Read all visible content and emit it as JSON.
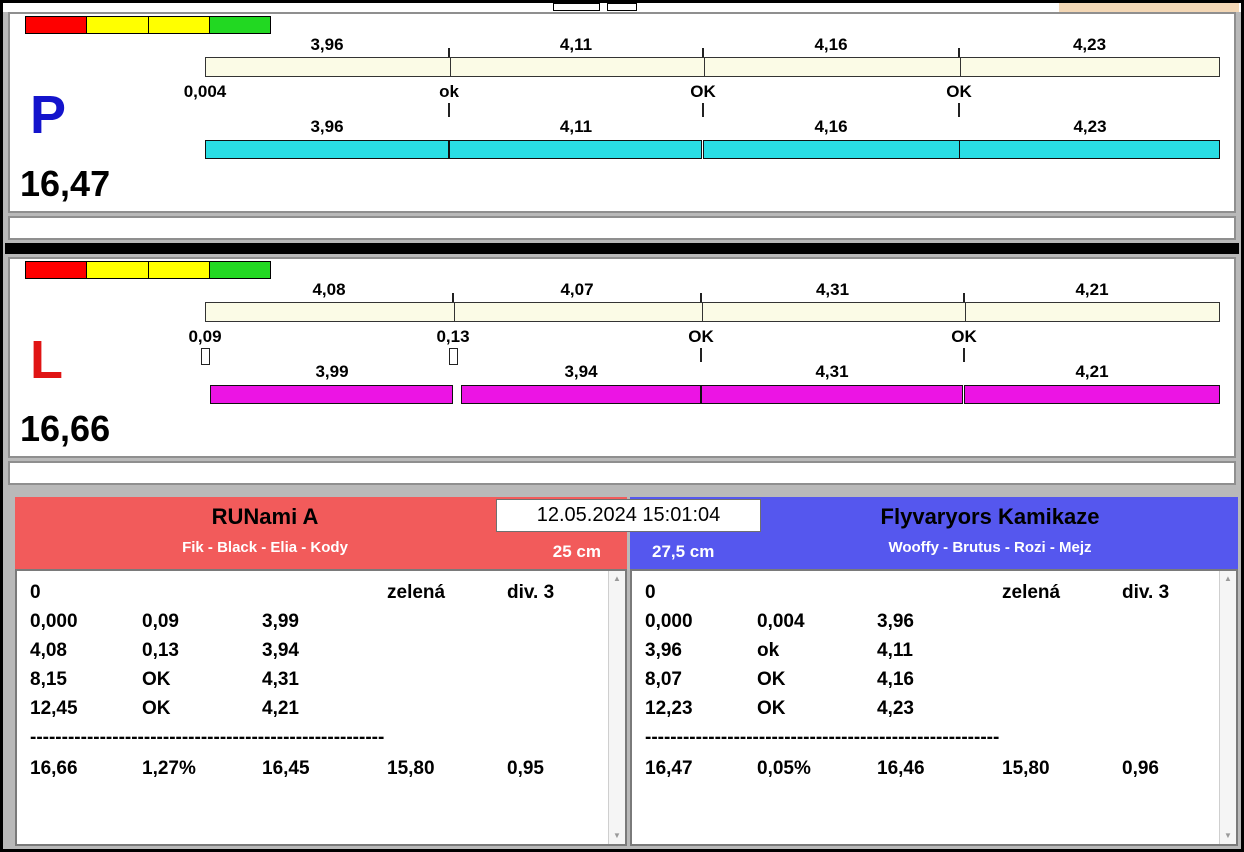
{
  "chrome": {
    "datetime": "12.05.2024 15:01:04"
  },
  "icons": {
    "scroll_up": "▲",
    "scroll_down": "▼"
  },
  "lanes": [
    {
      "letter": "P",
      "letter_color": "#1414cc",
      "total": "16,47",
      "traffic_colors": [
        "#fe0000",
        "#ffff00",
        "#ffff00",
        "#22d822"
      ],
      "ruler_color": "#fbfbe6",
      "bar_color": "#29dee4",
      "top_times": [
        "3,96",
        "4,11",
        "4,16",
        "4,23"
      ],
      "statuses": [
        "0,004",
        "ok",
        "OK",
        "OK"
      ],
      "markers": [
        "none",
        "tick",
        "tick",
        "tick"
      ],
      "bottom_times": [
        "3,96",
        "4,11",
        "4,16",
        "4,23"
      ]
    },
    {
      "letter": "L",
      "letter_color": "#e01414",
      "total": "16,66",
      "traffic_colors": [
        "#fe0000",
        "#ffff00",
        "#ffff00",
        "#22d822"
      ],
      "ruler_color": "#fbfbe6",
      "bar_color": "#ec14e4",
      "top_times": [
        "4,08",
        "4,07",
        "4,31",
        "4,21"
      ],
      "statuses": [
        "0,09",
        "0,13",
        "OK",
        "OK"
      ],
      "markers": [
        "box",
        "box",
        "tick",
        "tick"
      ],
      "bottom_times": [
        "3,99",
        "3,94",
        "4,31",
        "4,21"
      ]
    }
  ],
  "teams": [
    {
      "name": "RUNami A",
      "dogs": "Fik - Black - Elia - Kody",
      "height": "25 cm",
      "height_side": "right",
      "header_color": "#f25b5b",
      "rows": [
        [
          "0",
          "",
          "",
          "zelená",
          "div. 3"
        ],
        [
          "0,000",
          "0,09",
          "3,99",
          "",
          ""
        ],
        [
          "4,08",
          "0,13",
          "3,94",
          "",
          ""
        ],
        [
          "8,15",
          "OK",
          "4,31",
          "",
          ""
        ],
        [
          "12,45",
          "OK",
          "4,21",
          "",
          ""
        ]
      ],
      "separator": "--------------------------------------------------------",
      "totals": [
        "16,66",
        "1,27%",
        "16,45",
        "15,80",
        "0,95"
      ]
    },
    {
      "name": "Flyvaryors Kamikaze",
      "dogs": "Wooffy - Brutus - Rozi - Mejz",
      "height": "27,5 cm",
      "height_side": "left",
      "header_color": "#5557ee",
      "rows": [
        [
          "0",
          "",
          "",
          "zelená",
          "div. 3"
        ],
        [
          "0,000",
          "0,004",
          "3,96",
          "",
          ""
        ],
        [
          "3,96",
          "ok",
          "4,11",
          "",
          ""
        ],
        [
          "8,07",
          "OK",
          "4,16",
          "",
          ""
        ],
        [
          "12,23",
          "OK",
          "4,23",
          "",
          ""
        ]
      ],
      "separator": "--------------------------------------------------------",
      "totals": [
        "16,47",
        "0,05%",
        "16,46",
        "15,80",
        "0,96"
      ]
    }
  ]
}
